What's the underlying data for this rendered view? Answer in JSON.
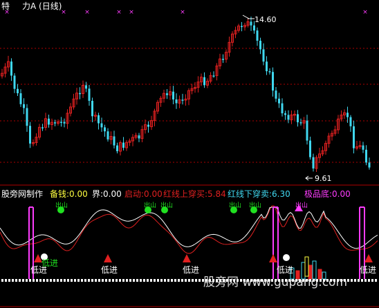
{
  "colors": {
    "background": "#000000",
    "bull": "#e02020",
    "bear": "#40d8f0",
    "grid": "#b00000",
    "magenta": "#ff3cff",
    "white": "#ffffff",
    "green": "#20e020",
    "yellow": "#ffff40"
  },
  "price_panel": {
    "title_left": "特",
    "title_right": "力A (日线)",
    "high_label": "14.60",
    "low_label": "9.61",
    "icons": [
      "magenta-x-icon",
      "price-arrow-icon"
    ]
  },
  "indicator_panel": {
    "name": "股旁网制作",
    "beiqian": "备钱:0.00",
    "jie": "界:0.00",
    "qidong": "启动:0.00",
    "hongxian_shang": "红线上穿买:5.84",
    "hongxian_xia": "红线下穿卖:6.30",
    "jipindi": "极品底:0.00",
    "dijin": "低进",
    "watermark": "股旁网 www.gupang.com",
    "marker_text": "出山"
  }
}
